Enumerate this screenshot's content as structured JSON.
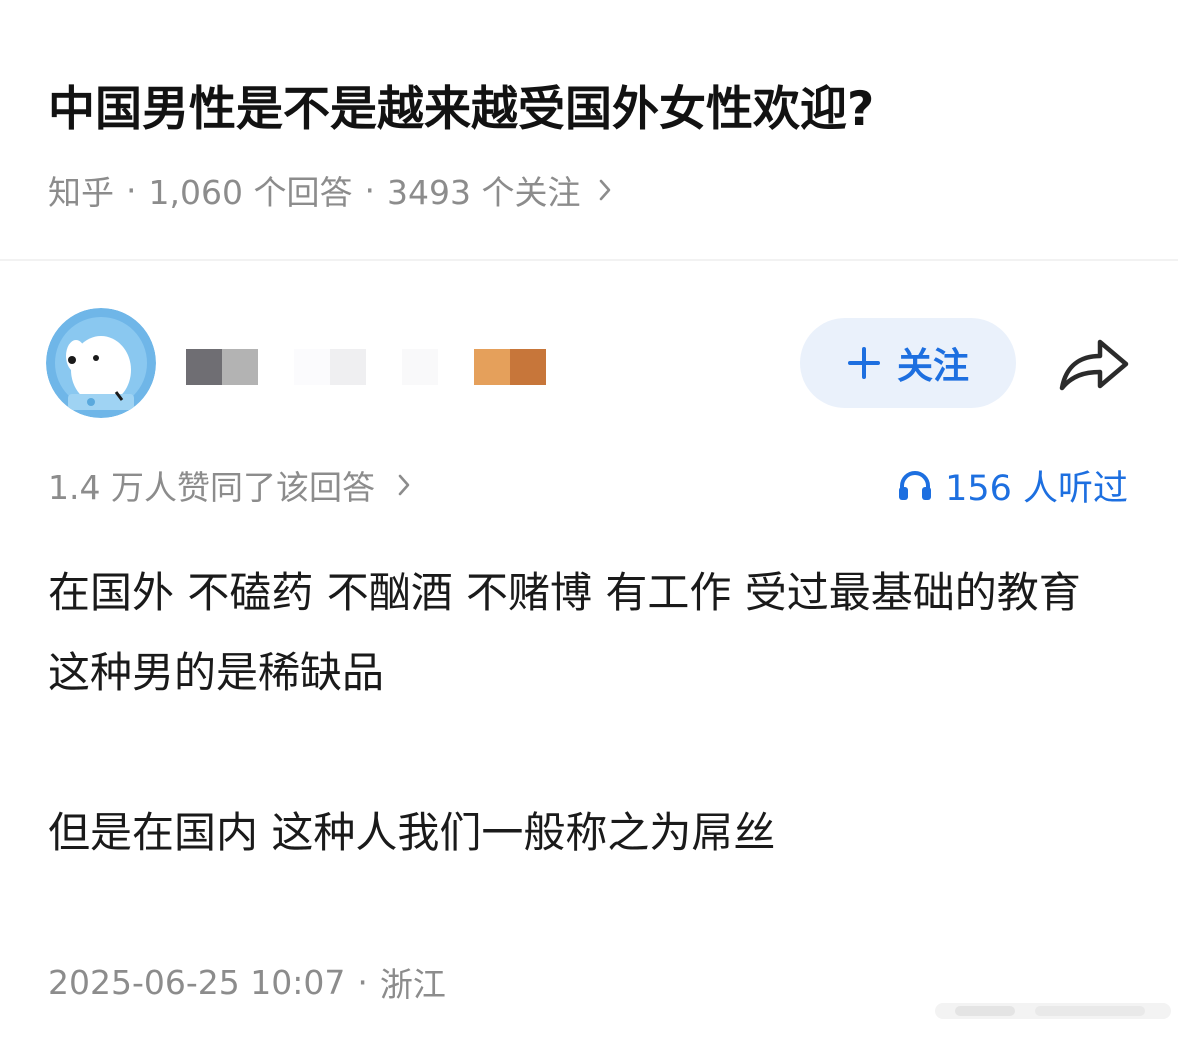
{
  "question": {
    "title": "中国男性是不是越来越受国外女性欢迎?",
    "source": "知乎",
    "separator": "·",
    "answer_count": "1,060 个回答",
    "follower_count": "3493 个关注"
  },
  "author": {
    "follow_label": "关注",
    "name_mosaic_colors": [
      "#6f6e73",
      "#b3b3b3",
      "#fbfbfd",
      "#efeff1",
      "#f9f9fa",
      "#e5a05b",
      "#c7763a"
    ]
  },
  "engagement": {
    "upvote_text": "1.4 万人赞同了该回答",
    "listen_text": "156 人听过"
  },
  "answer": {
    "paragraph_1": "在国外 不磕药 不酗酒 不赌博 有工作 受过最基础的教育 这种男的是稀缺品",
    "paragraph_2": "但是在国内 这种人我们一般称之为屌丝"
  },
  "footer": {
    "datetime": "2025-06-25 10:07",
    "separator": "·",
    "location": "浙江"
  },
  "icons": {
    "chevron": "chevron-right-icon",
    "plus": "plus-icon",
    "share": "share-icon",
    "headphones": "headphones-icon"
  },
  "colors": {
    "accent": "#1d6fe0",
    "follow_bg": "#eaf1fb",
    "meta_text": "#8c8c8c"
  }
}
